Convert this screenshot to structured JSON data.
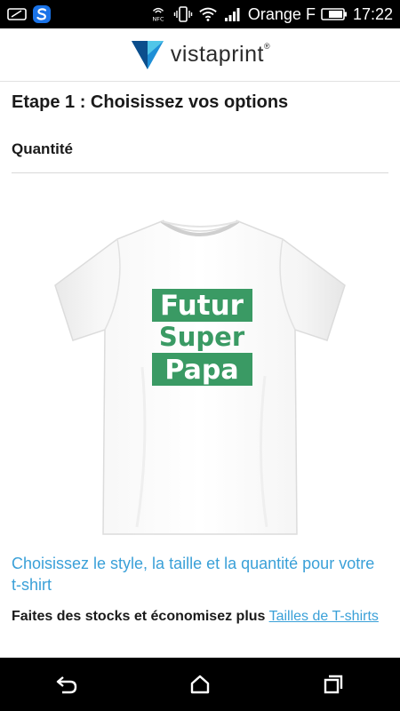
{
  "status_bar": {
    "carrier": "Orange F",
    "time": "17:22",
    "nfc_label": "NFC",
    "icons": [
      "eye-icon",
      "s-app-icon",
      "nfc-icon",
      "vibrate-icon",
      "wifi-icon",
      "signal-icon",
      "battery-icon"
    ]
  },
  "header": {
    "logo_text": "vistaprint",
    "logo_reg": "®",
    "brand_colors": [
      "#1e8fd6",
      "#0b4e8c",
      "#50c6e8"
    ]
  },
  "main": {
    "step_title": "Etape 1 : Choisissez vos options",
    "quantity_label": "Quantité",
    "product": {
      "shirt_lines": [
        "Futur",
        "Super",
        "Papa"
      ],
      "print_color": "#3a9a64"
    },
    "choose_link": "Choisissez le style, la taille et la quantité pour votre t-shirt",
    "stock_text": "Faites des stocks et économisez plus",
    "sizes_link": "Tailles de T-shirts"
  },
  "nav_bar": {
    "buttons": [
      "back-icon",
      "home-icon",
      "recents-icon"
    ]
  }
}
